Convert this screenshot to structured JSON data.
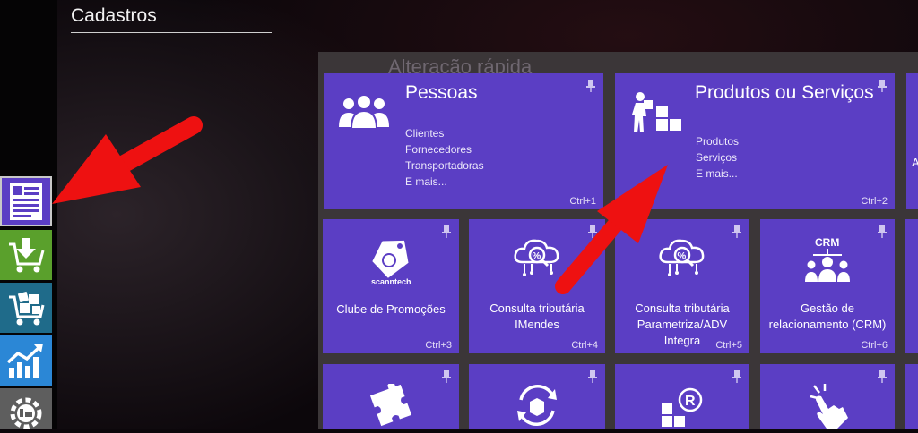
{
  "page": {
    "heading": "Cadastros",
    "panel_title": "Alteração rápida"
  },
  "sidebar": [
    {
      "icon": "document-icon",
      "color": "#5b3ec4"
    },
    {
      "icon": "cart-download-icon",
      "color": "#5aa02c"
    },
    {
      "icon": "cart-boxes-icon",
      "color": "#1f6b8a"
    },
    {
      "icon": "chart-growth-icon",
      "color": "#2b87d6"
    },
    {
      "icon": "gear-factory-icon",
      "color": "#5e5e5e"
    }
  ],
  "tiles": {
    "pessoas": {
      "title": "Pessoas",
      "items": [
        "Clientes",
        "Fornecedores",
        "Transportadoras",
        "E mais..."
      ],
      "shortcut": "Ctrl+1"
    },
    "produtos": {
      "title": "Produtos ou Serviços",
      "items": [
        "Produtos",
        "Serviços",
        "E mais..."
      ],
      "shortcut": "Ctrl+2"
    },
    "clube": {
      "label": "Clube de Promoções",
      "logo_text": "scanntech",
      "shortcut": "Ctrl+3"
    },
    "imendes": {
      "label_lines": [
        "Consulta tributária",
        "IMendes"
      ],
      "shortcut": "Ctrl+4"
    },
    "parametriza": {
      "label_lines": [
        "Consulta tributária",
        "Parametriza/ADV",
        "Integra"
      ],
      "shortcut": "Ctrl+5"
    },
    "crm": {
      "label_lines": [
        "Gestão de",
        "relacionamento (CRM)"
      ],
      "badge": "CRM",
      "shortcut": "Ctrl+6"
    },
    "edge_fragment": "A"
  },
  "colors": {
    "tile": "#5b3ec4",
    "panel": "#3b3638",
    "arrow": "#ee1111"
  }
}
